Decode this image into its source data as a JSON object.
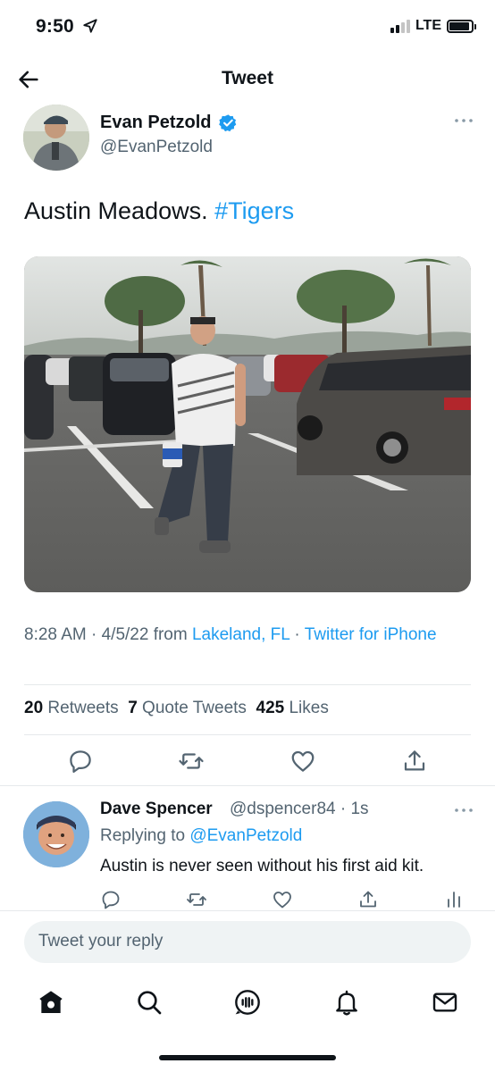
{
  "status_bar": {
    "time": "9:50",
    "network": "LTE"
  },
  "header": {
    "title": "Tweet"
  },
  "tweet": {
    "author_name": "Evan Petzold",
    "author_handle": "@EvanPetzold",
    "text_plain": "Austin Meadows.",
    "hashtag": "#Tigers",
    "time": "8:28 AM · 4/5/22 from",
    "location": "Lakeland, FL",
    "separator": "·",
    "client": "Twitter for iPhone"
  },
  "stats": {
    "retweets_count": "20",
    "retweets_label": "Retweets",
    "quotes_count": "7",
    "quotes_label": "Quote Tweets",
    "likes_count": "425",
    "likes_label": "Likes"
  },
  "reply": {
    "author_name": "Dave Spencer",
    "author_handle": "@dspencer84 · 1s",
    "replying_prefix": "Replying to",
    "replying_handle": "@EvanPetzold",
    "text": "Austin is never seen without his first aid kit."
  },
  "compose": {
    "placeholder": "Tweet your reply"
  },
  "icons": {
    "back": "arrow-left-icon",
    "verified": "verified-badge-icon",
    "more": "more-horizontal-icon",
    "reply": "reply-icon",
    "retweet": "retweet-icon",
    "like": "heart-icon",
    "share": "share-icon",
    "analytics": "analytics-icon",
    "home": "home-icon",
    "search": "search-icon",
    "spaces": "spaces-icon",
    "notifications": "bell-icon",
    "messages": "mail-icon"
  },
  "colors": {
    "accent": "#1d9bf0",
    "text": "#0f1419",
    "secondary": "#536471"
  }
}
